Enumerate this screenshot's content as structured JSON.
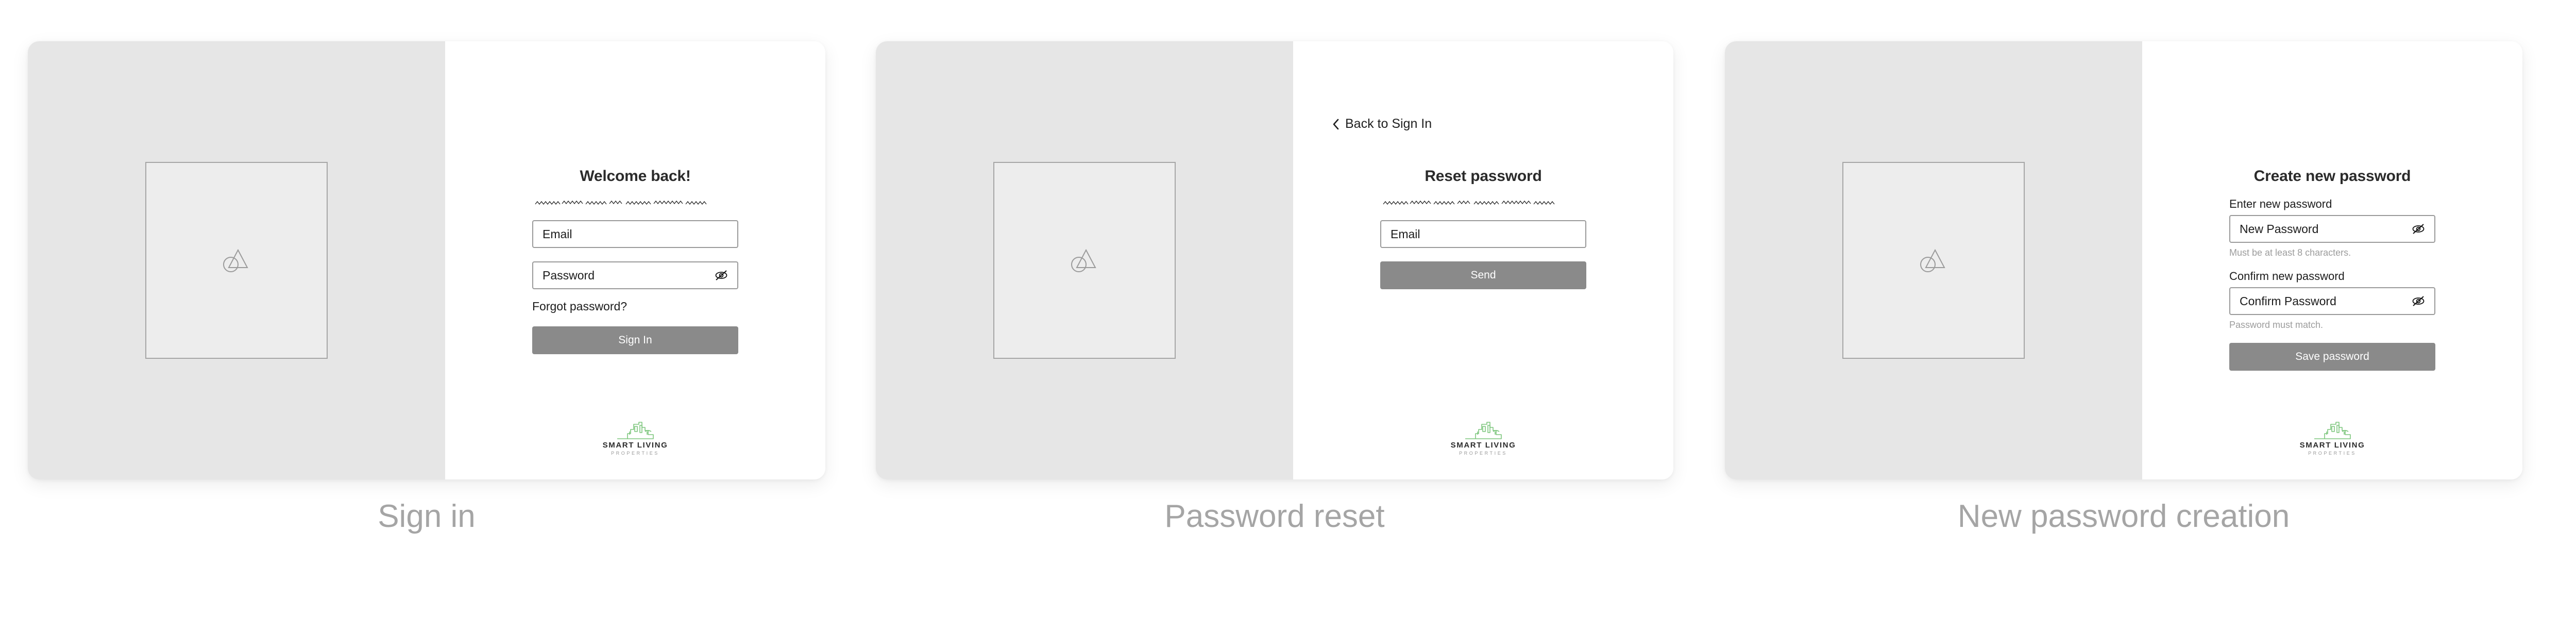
{
  "colors": {
    "page_background": "#ffffff",
    "card_background": "#ffffff",
    "hero_background": "#e6e6e6",
    "placeholder_fill": "#ededed",
    "placeholder_border": "#a6a6a6",
    "field_border": "#9a9a9a",
    "button_fill": "#8a8a8a",
    "button_text": "#ffffff",
    "title_text": "#2b2b2b",
    "hint_text": "#9c9c9c",
    "caption_text": "#a5a5a5",
    "brand_green": "#7dc67d",
    "brand_dark": "#2b2b2b"
  },
  "brand": {
    "mark_icon": "building-skyline-icon",
    "name": "SMART LIVING",
    "subtitle": "PROPERTIES"
  },
  "shared": {
    "image_placeholder_icon": "image-placeholder-icon",
    "eye_off_icon": "eye-off-icon",
    "chevron_left_icon": "chevron-left-icon",
    "redacted_subtitle_icon": "scribble-redacted-text"
  },
  "screens": [
    {
      "id": "sign-in",
      "caption": "Sign in",
      "has_back_link": false,
      "back_link_label": "",
      "title": "Welcome back!",
      "has_redacted_subtitle": true,
      "fields": [
        {
          "name": "email-field",
          "label": "",
          "placeholder": "Email",
          "has_eye_toggle": false,
          "hint": ""
        },
        {
          "name": "password-field",
          "label": "",
          "placeholder": "Password",
          "has_eye_toggle": true,
          "hint": ""
        }
      ],
      "forgot_password_label": "Forgot password?",
      "submit_label": "Sign In"
    },
    {
      "id": "password-reset",
      "caption": "Password reset",
      "has_back_link": true,
      "back_link_label": "Back to Sign In",
      "title": "Reset password",
      "has_redacted_subtitle": true,
      "fields": [
        {
          "name": "email-field",
          "label": "",
          "placeholder": "Email",
          "has_eye_toggle": false,
          "hint": ""
        }
      ],
      "forgot_password_label": "",
      "submit_label": "Send"
    },
    {
      "id": "new-password-creation",
      "caption": "New password creation",
      "has_back_link": false,
      "back_link_label": "",
      "title": "Create new password",
      "has_redacted_subtitle": false,
      "fields": [
        {
          "name": "new-password-field",
          "label": "Enter new password",
          "placeholder": "New Password",
          "has_eye_toggle": true,
          "hint": "Must be at least 8 characters."
        },
        {
          "name": "confirm-password-field",
          "label": "Confirm new password",
          "placeholder": "Confirm Password",
          "has_eye_toggle": true,
          "hint": "Password must match."
        }
      ],
      "forgot_password_label": "",
      "submit_label": "Save password"
    }
  ]
}
